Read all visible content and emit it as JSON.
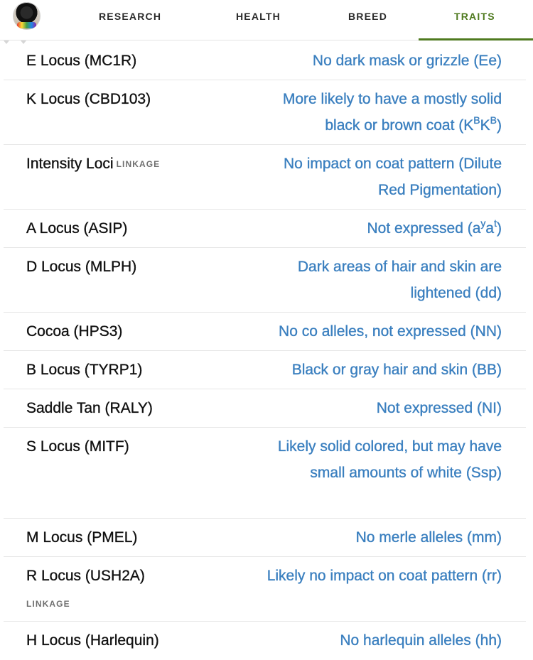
{
  "nav": {
    "avatar_icon": "dog-profile-avatar",
    "tabs": [
      {
        "label": "RESEARCH"
      },
      {
        "label": "HEALTH"
      },
      {
        "label": "BREED"
      },
      {
        "label": "TRAITS",
        "active": true
      }
    ],
    "active_color": "#4f7a1f"
  },
  "result_color": "#3a7fbf",
  "traits": [
    {
      "name": "E Locus (MC1R)",
      "result": "No dark mask or grizzle (Ee)"
    },
    {
      "name": "K Locus (CBD103)",
      "result_pre": "More likely to have a mostly solid black or brown coat (K",
      "sup1": "B",
      "result_mid": "K",
      "sup2": "B",
      "result_post": ")"
    },
    {
      "name": "Intensity Loci",
      "tag": "LINKAGE",
      "result": "No impact on coat pattern (Dilute Red Pigmentation)"
    },
    {
      "name": "A Locus (ASIP)",
      "result_pre": "Not expressed (a",
      "sup1": "y",
      "result_mid": "a",
      "sup2": "t",
      "result_post": ")"
    },
    {
      "name": "D Locus (MLPH)",
      "result": "Dark areas of hair and skin are lightened (dd)"
    },
    {
      "name": "Cocoa (HPS3)",
      "result": "No co alleles, not expressed (NN)"
    },
    {
      "name": "B Locus (TYRP1)",
      "result": "Black or gray hair and skin (BB)"
    },
    {
      "name": "Saddle Tan (RALY)",
      "result": "Not expressed (NI)"
    },
    {
      "name": "S Locus (MITF)",
      "result": "Likely solid colored, but may have small amounts of white (Ssp)"
    },
    {
      "name": "M Locus (PMEL)",
      "result": "No merle alleles (mm)"
    },
    {
      "name": "R Locus (USH2A)",
      "tag": "LINKAGE",
      "result": "Likely no impact on coat pattern (rr)"
    },
    {
      "name": "H Locus (Harlequin)",
      "result": "No harlequin alleles (hh)"
    }
  ]
}
